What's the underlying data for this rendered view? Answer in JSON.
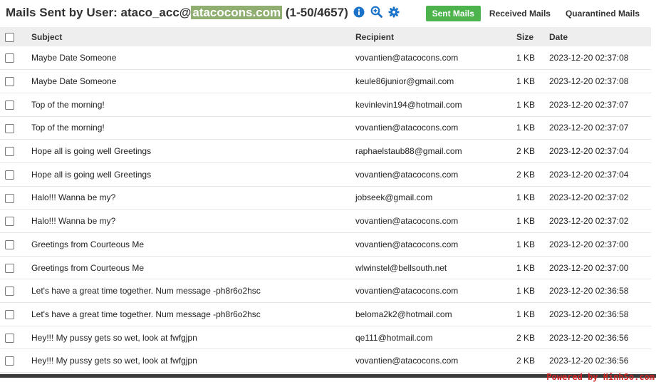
{
  "header": {
    "title_prefix": "Mails Sent by User: ataco_acc@",
    "title_domain": "atacocons.com",
    "title_range": " (1-50/4657)",
    "icons": [
      "info-icon",
      "zoom-in-icon",
      "gear-icon"
    ]
  },
  "tabs": [
    {
      "label": "Sent Mails",
      "active": true
    },
    {
      "label": "Received Mails",
      "active": false
    },
    {
      "label": "Quarantined Mails",
      "active": false
    }
  ],
  "columns": {
    "subject": "Subject",
    "recipient": "Recipient",
    "size": "Size",
    "date": "Date"
  },
  "rows": [
    {
      "subject": "Maybe Date Someone",
      "recipient": "vovantien@atacocons.com",
      "size": "1 KB",
      "date": "2023-12-20 02:37:08"
    },
    {
      "subject": "Maybe Date Someone",
      "recipient": "keule86junior@gmail.com",
      "size": "1 KB",
      "date": "2023-12-20 02:37:08"
    },
    {
      "subject": "Top of the morning!",
      "recipient": "kevinlevin194@hotmail.com",
      "size": "1 KB",
      "date": "2023-12-20 02:37:07"
    },
    {
      "subject": "Top of the morning!",
      "recipient": "vovantien@atacocons.com",
      "size": "1 KB",
      "date": "2023-12-20 02:37:07"
    },
    {
      "subject": "Hope all is going well Greetings",
      "recipient": "raphaelstaub88@gmail.com",
      "size": "2 KB",
      "date": "2023-12-20 02:37:04"
    },
    {
      "subject": "Hope all is going well Greetings",
      "recipient": "vovantien@atacocons.com",
      "size": "2 KB",
      "date": "2023-12-20 02:37:04"
    },
    {
      "subject": "Halo!!! Wanna be my?",
      "recipient": "jobseek@gmail.com",
      "size": "1 KB",
      "date": "2023-12-20 02:37:02"
    },
    {
      "subject": "Halo!!! Wanna be my?",
      "recipient": "vovantien@atacocons.com",
      "size": "1 KB",
      "date": "2023-12-20 02:37:02"
    },
    {
      "subject": "Greetings from Courteous Me",
      "recipient": "vovantien@atacocons.com",
      "size": "1 KB",
      "date": "2023-12-20 02:37:00"
    },
    {
      "subject": "Greetings from Courteous Me",
      "recipient": "wlwinstel@bellsouth.net",
      "size": "1 KB",
      "date": "2023-12-20 02:37:00"
    },
    {
      "subject": "Let's have a great time together. Num message -ph8r6o2hsc",
      "recipient": "vovantien@atacocons.com",
      "size": "1 KB",
      "date": "2023-12-20 02:36:58"
    },
    {
      "subject": "Let's have a great time together. Num message -ph8r6o2hsc",
      "recipient": "beloma2k2@hotmail.com",
      "size": "1 KB",
      "date": "2023-12-20 02:36:58"
    },
    {
      "subject": "Hey!!! My pussy gets so wet, look at fwfgjpn",
      "recipient": "qe111@hotmail.com",
      "size": "2 KB",
      "date": "2023-12-20 02:36:56"
    },
    {
      "subject": "Hey!!! My pussy gets so wet, look at fwfgjpn",
      "recipient": "vovantien@atacocons.com",
      "size": "2 KB",
      "date": "2023-12-20 02:36:56"
    }
  ],
  "footer": {
    "powered_by": "Powered by HinhSo.com"
  },
  "colors": {
    "active_tab": "#4db34d",
    "icon_blue": "#1a73c9",
    "header_row": "#eeeeee"
  }
}
